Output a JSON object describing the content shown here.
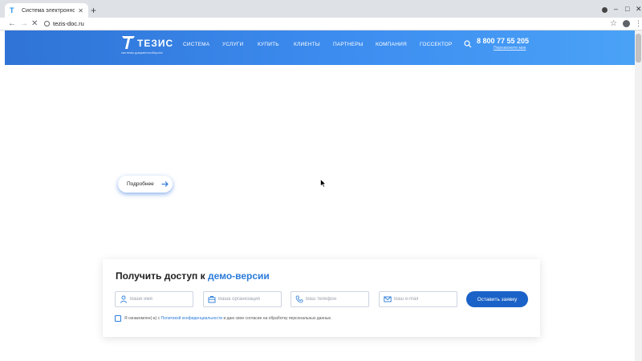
{
  "browser": {
    "tab_title": "Система электронного до",
    "url": "tezis-doc.ru"
  },
  "header": {
    "logo_text": "ТЕЗИС",
    "logo_subtitle": "системы документооборота",
    "menu": [
      "СИСТЕМА",
      "УСЛУГИ",
      "КУПИТЬ",
      "КЛИЕНТЫ",
      "ПАРТНЕРЫ",
      "КОМПАНИЯ",
      "ГОССЕКТОР"
    ],
    "phone": "8 800 77 55 205",
    "callback": "Перезвоните мне"
  },
  "hero": {
    "more_button": "Подробнее"
  },
  "demo_form": {
    "title_prefix": "Получить доступ к",
    "title_accent": "демо-версии",
    "fields": {
      "name": "Ваше имя",
      "organization": "Ваша организация",
      "phone": "Ваш телефон",
      "email": "Ваш e-mail"
    },
    "submit": "Оставить заявку",
    "consent_before": "Я ознакомлен(-а) с",
    "consent_link": "Политикой конфиденциальности",
    "consent_after": "и даю свое согласие на обработку персональных данных."
  },
  "colors": {
    "header_gradient_start": "#2f73d6",
    "header_gradient_end": "#4aa2f6",
    "accent": "#2b7bd9",
    "button": "#1a62c7"
  },
  "icons": [
    "favicon",
    "back-arrow-icon",
    "forward-arrow-icon",
    "stop-icon",
    "lock-icon",
    "star-icon",
    "profile-icon",
    "menu-kebab-icon",
    "search-icon",
    "arrow-right-icon",
    "user-icon",
    "briefcase-icon",
    "phone-icon",
    "mail-icon"
  ]
}
